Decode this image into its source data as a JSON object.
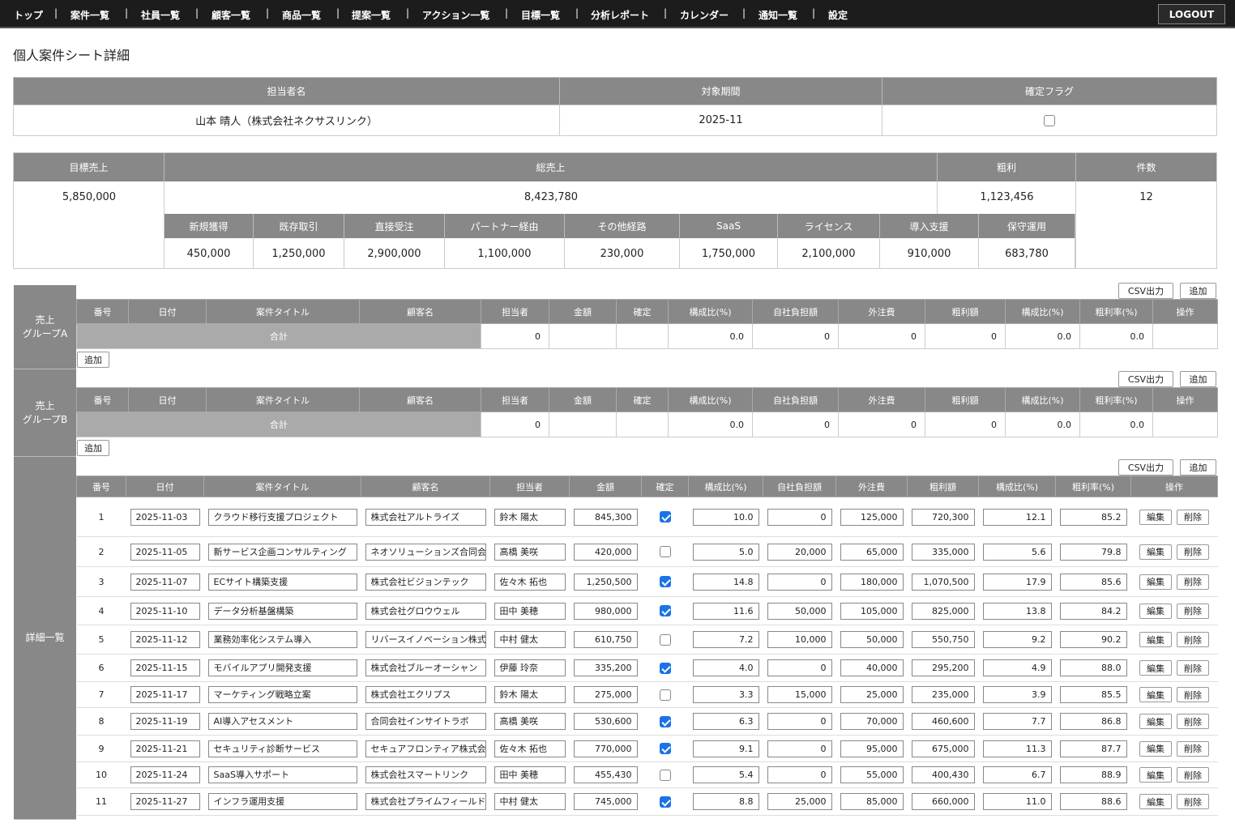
{
  "nav": {
    "items": [
      "トップ",
      "案件一覧",
      "社員一覧",
      "顧客一覧",
      "商品一覧",
      "提案一覧",
      "アクション一覧",
      "目標一覧",
      "分析レポート",
      "カレンダー",
      "通知一覧",
      "設定"
    ],
    "logout": "LOGOUT"
  },
  "page": {
    "title": "個人案件シート詳細"
  },
  "info": {
    "headers": [
      "担当者名",
      "対象期間",
      "確定フラグ"
    ],
    "person": "山本 晴人（株式会社ネクサスリンク）",
    "period": "2025-11",
    "confirmed": false
  },
  "summary": {
    "headers": [
      "目標売上",
      "総売上",
      "粗利",
      "件数"
    ],
    "target_sales": "5,850,000",
    "total_sales": "8,423,780",
    "gross_profit": "1,123,456",
    "count": "12",
    "breakdown_headers": [
      "新規獲得",
      "既存取引",
      "直接受注",
      "パートナー経由",
      "その他経路",
      "SaaS",
      "ライセンス",
      "導入支援",
      "保守運用"
    ],
    "breakdown_values": [
      "450,000",
      "1,250,000",
      "2,900,000",
      "1,100,000",
      "230,000",
      "1,750,000",
      "2,100,000",
      "910,000",
      "683,780"
    ]
  },
  "buttons": {
    "csv": "CSV出力",
    "add": "追加",
    "edit": "編集",
    "delete": "削除"
  },
  "columns": [
    "番号",
    "日付",
    "案件タイトル",
    "顧客名",
    "担当者",
    "金額",
    "確定",
    "構成比(%)",
    "自社負担額",
    "外注費",
    "粗利額",
    "構成比(%)",
    "粗利率(%)",
    "操作"
  ],
  "groups": [
    {
      "label": "売上\nグループA",
      "total_label": "合計",
      "totals": {
        "person": "0",
        "ratio": "0.0",
        "own": "0",
        "outsource": "0",
        "gross": "0",
        "gross_ratio": "0.0",
        "margin": "0.0"
      }
    },
    {
      "label": "売上\nグループB",
      "total_label": "合計",
      "totals": {
        "person": "0",
        "ratio": "0.0",
        "own": "0",
        "outsource": "0",
        "gross": "0",
        "gross_ratio": "0.0",
        "margin": "0.0"
      }
    }
  ],
  "detail": {
    "label": "詳細一覧",
    "rows": [
      {
        "no": "1",
        "date": "2025-11-03",
        "title": "クラウド移行支援プロジェクト",
        "customer": "株式会社アルトライズ",
        "person": "鈴木 陽太",
        "amount": "845,300",
        "confirmed": true,
        "ratio": "10.0",
        "own": "0",
        "outsource": "125,000",
        "gross": "720,300",
        "gross_ratio": "12.1",
        "margin": "85.2"
      },
      {
        "no": "2",
        "date": "2025-11-05",
        "title": "新サービス企画コンサルティング",
        "customer": "ネオソリューションズ合同会社",
        "person": "高橋 美咲",
        "amount": "420,000",
        "confirmed": false,
        "ratio": "5.0",
        "own": "20,000",
        "outsource": "65,000",
        "gross": "335,000",
        "gross_ratio": "5.6",
        "margin": "79.8"
      },
      {
        "no": "3",
        "date": "2025-11-07",
        "title": "ECサイト構築支援",
        "customer": "株式会社ビジョンテック",
        "person": "佐々木 拓也",
        "amount": "1,250,500",
        "confirmed": true,
        "ratio": "14.8",
        "own": "0",
        "outsource": "180,000",
        "gross": "1,070,500",
        "gross_ratio": "17.9",
        "margin": "85.6"
      },
      {
        "no": "4",
        "date": "2025-11-10",
        "title": "データ分析基盤構築",
        "customer": "株式会社グロウウェル",
        "person": "田中 美穂",
        "amount": "980,000",
        "confirmed": true,
        "ratio": "11.6",
        "own": "50,000",
        "outsource": "105,000",
        "gross": "825,000",
        "gross_ratio": "13.8",
        "margin": "84.2"
      },
      {
        "no": "5",
        "date": "2025-11-12",
        "title": "業務効率化システム導入",
        "customer": "リバースイノベーション株式会社",
        "person": "中村 健太",
        "amount": "610,750",
        "confirmed": false,
        "ratio": "7.2",
        "own": "10,000",
        "outsource": "50,000",
        "gross": "550,750",
        "gross_ratio": "9.2",
        "margin": "90.2"
      },
      {
        "no": "6",
        "date": "2025-11-15",
        "title": "モバイルアプリ開発支援",
        "customer": "株式会社ブルーオーシャン",
        "person": "伊藤 玲奈",
        "amount": "335,200",
        "confirmed": true,
        "ratio": "4.0",
        "own": "0",
        "outsource": "40,000",
        "gross": "295,200",
        "gross_ratio": "4.9",
        "margin": "88.0"
      },
      {
        "no": "7",
        "date": "2025-11-17",
        "title": "マーケティング戦略立案",
        "customer": "株式会社エクリプス",
        "person": "鈴木 陽太",
        "amount": "275,000",
        "confirmed": false,
        "ratio": "3.3",
        "own": "15,000",
        "outsource": "25,000",
        "gross": "235,000",
        "gross_ratio": "3.9",
        "margin": "85.5"
      },
      {
        "no": "8",
        "date": "2025-11-19",
        "title": "AI導入アセスメント",
        "customer": "合同会社インサイトラボ",
        "person": "高橋 美咲",
        "amount": "530,600",
        "confirmed": true,
        "ratio": "6.3",
        "own": "0",
        "outsource": "70,000",
        "gross": "460,600",
        "gross_ratio": "7.7",
        "margin": "86.8"
      },
      {
        "no": "9",
        "date": "2025-11-21",
        "title": "セキュリティ診断サービス",
        "customer": "セキュアフロンティア株式会社",
        "person": "佐々木 拓也",
        "amount": "770,000",
        "confirmed": true,
        "ratio": "9.1",
        "own": "0",
        "outsource": "95,000",
        "gross": "675,000",
        "gross_ratio": "11.3",
        "margin": "87.7"
      },
      {
        "no": "10",
        "date": "2025-11-24",
        "title": "SaaS導入サポート",
        "customer": "株式会社スマートリンク",
        "person": "田中 美穂",
        "amount": "455,430",
        "confirmed": false,
        "ratio": "5.4",
        "own": "0",
        "outsource": "55,000",
        "gross": "400,430",
        "gross_ratio": "6.7",
        "margin": "88.9"
      },
      {
        "no": "11",
        "date": "2025-11-27",
        "title": "インフラ運用支援",
        "customer": "株式会社プライムフィールド",
        "person": "中村 健太",
        "amount": "745,000",
        "confirmed": true,
        "ratio": "8.8",
        "own": "25,000",
        "outsource": "85,000",
        "gross": "660,000",
        "gross_ratio": "11.0",
        "margin": "88.6"
      }
    ]
  }
}
